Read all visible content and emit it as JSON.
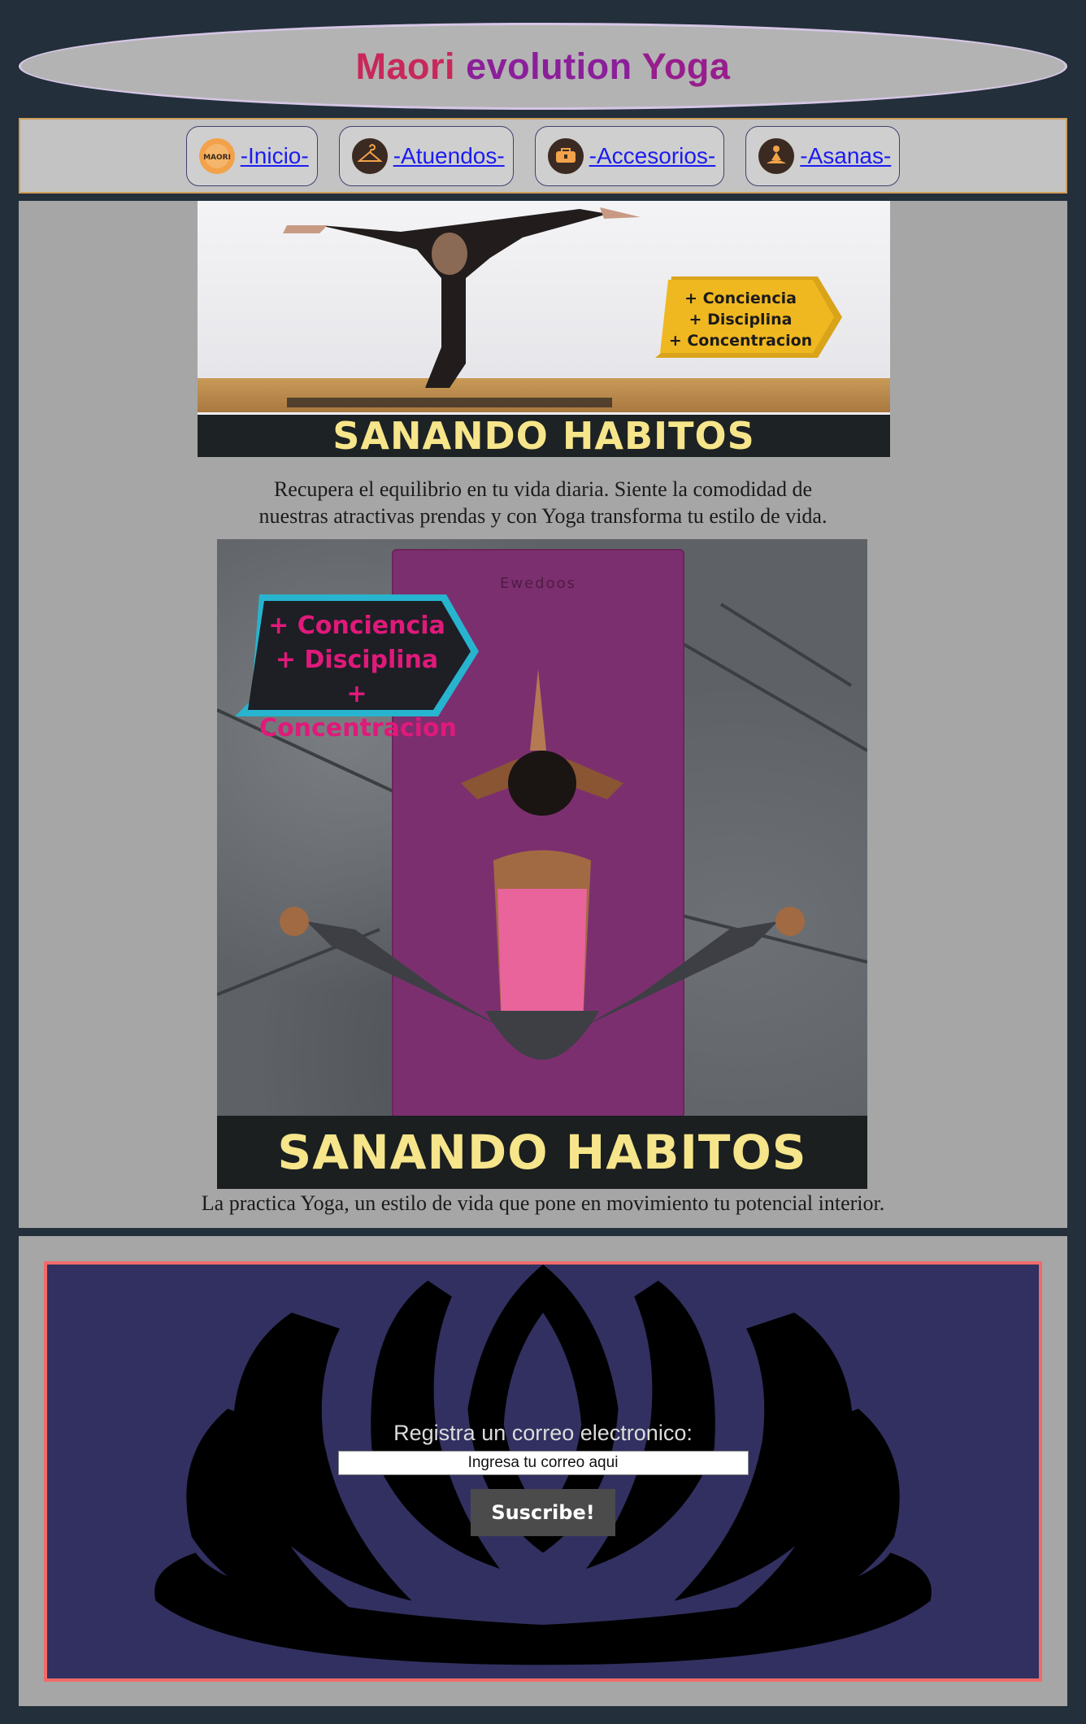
{
  "header": {
    "title_part1": "Maori",
    "title_part2": "evolution",
    "title_part3": "Yoga"
  },
  "nav": {
    "items": [
      {
        "label": "-Inicio-",
        "icon": "maori-logo-icon",
        "icon_text": "MAORI"
      },
      {
        "label": "-Atuendos-",
        "icon": "hanger-icon"
      },
      {
        "label": "-Accesorios-",
        "icon": "bag-icon"
      },
      {
        "label": "-Asanas-",
        "icon": "meditation-icon"
      }
    ]
  },
  "banner1": {
    "title": "SANANDO HABITOS",
    "tag_lines": [
      "+ Conciencia",
      "+ Disciplina",
      "+ Concentracion"
    ]
  },
  "caption1": {
    "line1": "Recupera el equilibrio en tu vida diaria. Siente la comodidad de",
    "line2": "nuestras atractivas prendas y con Yoga transforma tu estilo de vida."
  },
  "banner2": {
    "title": "SANANDO HABITOS",
    "mat_brand": "Ewedoos",
    "tag_lines": [
      "+ Conciencia",
      "+ Disciplina",
      "+ Concentracion"
    ]
  },
  "caption2": "La practica Yoga, un estilo de vida que pone en movimiento tu potencial interior.",
  "subscribe": {
    "label": "Registra un correo electronico:",
    "placeholder": "Ingresa tu correo aqui",
    "button": "Suscribe!"
  },
  "colors": {
    "background": "#232f3a",
    "title_maori": "#c8285a",
    "title_evolution": "#8b1f9a",
    "nav_link": "#1c1cf0",
    "banner_text": "#f6e58a",
    "subscribe_bg": "#313060",
    "subscribe_border": "#f06a6a"
  }
}
